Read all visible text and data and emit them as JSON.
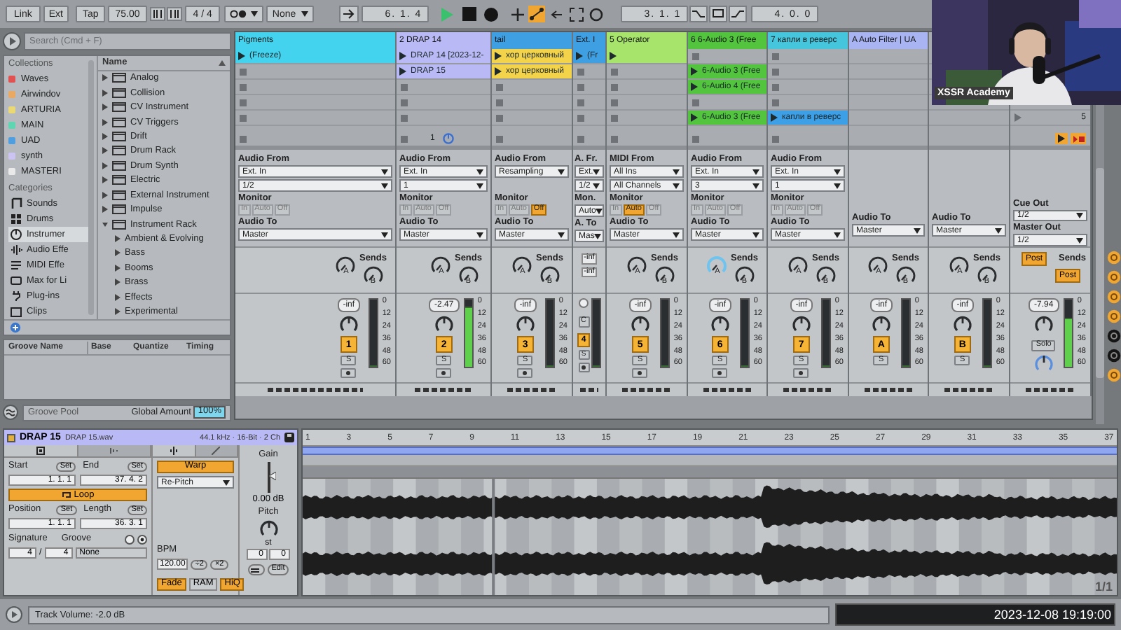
{
  "transport": {
    "link": "Link",
    "ext": "Ext",
    "tap": "Tap",
    "tempo": "75.00",
    "signature": "4 / 4",
    "quantize": "None",
    "position": "6. 1. 4",
    "playing": true,
    "loop_start": "3. 1. 1",
    "loop_length": "4. 0. 0"
  },
  "browser": {
    "search": {
      "placeholder": "Search (Cmd + F)"
    },
    "collections_label": "Collections",
    "collections": [
      {
        "label": "Waves",
        "color": "#e05252"
      },
      {
        "label": "Airwindov",
        "color": "#e9a963"
      },
      {
        "label": "ARTURIA",
        "color": "#e9d873"
      },
      {
        "label": "MAIN",
        "color": "#5fd6b2"
      },
      {
        "label": "UAD",
        "color": "#4f9fe0"
      },
      {
        "label": "synth",
        "color": "#cbc3f2"
      },
      {
        "label": "MASTERI",
        "color": "#e9e9e9"
      }
    ],
    "categories_label": "Categories",
    "categories": [
      {
        "label": "Sounds",
        "selected": false
      },
      {
        "label": "Drums",
        "selected": false
      },
      {
        "label": "Instrumer",
        "selected": true
      },
      {
        "label": "Audio Effe",
        "selected": false
      },
      {
        "label": "MIDI Effe",
        "selected": false
      },
      {
        "label": "Max for Li",
        "selected": false
      },
      {
        "label": "Plug-ins",
        "selected": false
      },
      {
        "label": "Clips",
        "selected": false
      }
    ],
    "name_header": "Name",
    "items": [
      {
        "label": "Analog",
        "expanded": false
      },
      {
        "label": "Collision",
        "expanded": false
      },
      {
        "label": "CV Instrument",
        "expanded": false
      },
      {
        "label": "CV Triggers",
        "expanded": false
      },
      {
        "label": "Drift",
        "expanded": false
      },
      {
        "label": "Drum Rack",
        "expanded": false
      },
      {
        "label": "Drum Synth",
        "expanded": false
      },
      {
        "label": "Electric",
        "expanded": false
      },
      {
        "label": "External Instrument",
        "expanded": false
      },
      {
        "label": "Impulse",
        "expanded": false
      },
      {
        "label": "Instrument Rack",
        "expanded": true,
        "children": [
          {
            "label": "Ambient & Evolving"
          },
          {
            "label": "Bass"
          },
          {
            "label": "Booms"
          },
          {
            "label": "Brass"
          },
          {
            "label": "Effects"
          },
          {
            "label": "Experimental"
          }
        ]
      }
    ]
  },
  "groove": {
    "columns": [
      "Groove Name",
      "Base",
      "Quantize",
      "Timing"
    ],
    "footer": "Groove Pool",
    "amount_label": "Global Amount",
    "amount": "100%"
  },
  "tracks": [
    {
      "kind": "audio",
      "name": "Pigments",
      "color": "#43d3ee",
      "slots": [
        {
          "kind": "clip",
          "text": "(Freeze)",
          "color": "#43d3ee"
        },
        {
          "kind": "empty"
        },
        {
          "kind": "empty"
        },
        {
          "kind": "empty"
        },
        {
          "kind": "empty"
        }
      ],
      "io": {
        "from_label": "Audio From",
        "from": "Ext. In",
        "channel": "1/2",
        "monitor_label": "Monitor",
        "monitor": [
          {
            "label": "In",
            "selected": false
          },
          {
            "label": "Auto",
            "selected": false
          },
          {
            "label": "Off",
            "selected": false
          }
        ],
        "to_label": "Audio To",
        "to": "Master"
      },
      "sends_label": "Sends",
      "sends": [
        {
          "label": "A",
          "active": false
        },
        {
          "label": "B",
          "active": false
        }
      ],
      "volume": "-inf",
      "number": "1",
      "solo": "S",
      "arm": true,
      "meter": {
        "level": 0
      },
      "scale": [
        "0",
        "12",
        "24",
        "36",
        "48",
        "60"
      ]
    },
    {
      "kind": "audio",
      "name": "2 DRAP 14",
      "color": "#b9b9f5",
      "slots": [
        {
          "kind": "clip",
          "text": "DRAP 14 [2023-12-",
          "color": "#b9b9f5"
        },
        {
          "kind": "clip",
          "text": "DRAP 15",
          "color": "#b9b9f5"
        },
        {
          "kind": "empty"
        },
        {
          "kind": "empty"
        },
        {
          "kind": "empty"
        }
      ],
      "stop_label": "1",
      "io": {
        "from_label": "Audio From",
        "from": "Ext. In",
        "channel": "1",
        "monitor_label": "Monitor",
        "monitor": [
          {
            "label": "In",
            "selected": false
          },
          {
            "label": "Auto",
            "selected": false
          },
          {
            "label": "Off",
            "selected": false
          }
        ],
        "to_label": "Audio To",
        "to": "Master"
      },
      "sends_label": "Sends",
      "sends": [
        {
          "label": "A",
          "active": false
        },
        {
          "label": "B",
          "active": false
        }
      ],
      "volume": "-2.47",
      "number": "2",
      "solo": "S",
      "arm": true,
      "meter": {
        "level": 0.88
      },
      "scale": [
        "0",
        "12",
        "24",
        "36",
        "48",
        "60"
      ]
    },
    {
      "kind": "audio",
      "name": "tail",
      "color": "#3f9fe3",
      "slots": [
        {
          "kind": "clip",
          "text": "хор церковный",
          "color": "#f3d349"
        },
        {
          "kind": "clip",
          "text": "хор церковный",
          "color": "#f3d349"
        },
        {
          "kind": "empty"
        },
        {
          "kind": "empty"
        },
        {
          "kind": "empty"
        }
      ],
      "io": {
        "from_label": "Audio From",
        "from": "Resampling",
        "monitor_label": "Monitor",
        "monitor": [
          {
            "label": "In",
            "selected": false
          },
          {
            "label": "Auto",
            "selected": false
          },
          {
            "label": "Off",
            "selected": true
          }
        ],
        "to_label": "Audio To",
        "to": "Master"
      },
      "sends_label": "Sends",
      "sends": [
        {
          "label": "A",
          "active": false
        },
        {
          "label": "B",
          "active": false
        }
      ],
      "volume": "-inf",
      "number": "3",
      "solo": "S",
      "arm": true,
      "meter": {
        "level": 0
      },
      "scale": [
        "0",
        "12",
        "24",
        "36",
        "48",
        "60"
      ]
    },
    {
      "kind": "narrow",
      "name": "Ext. I",
      "color": "#3f9fe3",
      "slots": [
        {
          "kind": "clip",
          "text": "(Fr",
          "color": "#3f9fe3"
        },
        {
          "kind": "empty"
        },
        {
          "kind": "empty"
        },
        {
          "kind": "empty"
        },
        {
          "kind": "empty"
        }
      ],
      "io": {
        "from_label": "A. Fr.",
        "from": "Ext.",
        "channel": "1/2",
        "monitor_label": "Mon.",
        "monitor_value": "Auto",
        "to_label": "A. To",
        "to": "Mas"
      },
      "send_values": [
        "-inf",
        "-inf"
      ],
      "crossfade": "C",
      "number": "4",
      "solo": "S",
      "arm": true,
      "meter": {
        "level": 0
      }
    },
    {
      "kind": "midi",
      "name": "5 Operator",
      "color": "#a6e46c",
      "slots": [
        {
          "kind": "clip",
          "color": "#a6e46c"
        },
        {
          "kind": "empty"
        },
        {
          "kind": "empty"
        },
        {
          "kind": "empty"
        },
        {
          "kind": "empty"
        }
      ],
      "io": {
        "from_label": "MIDI From",
        "from": "All Ins",
        "channel": "All Channels",
        "monitor_label": "Monitor",
        "monitor": [
          {
            "label": "In",
            "selected": false
          },
          {
            "label": "Auto",
            "selected": true
          },
          {
            "label": "Off",
            "selected": false
          }
        ],
        "to_label": "Audio To",
        "to": "Master"
      },
      "sends_label": "Sends",
      "sends": [
        {
          "label": "A",
          "active": false
        },
        {
          "label": "B",
          "active": false
        }
      ],
      "volume": "-inf",
      "number": "5",
      "solo": "S",
      "arm": true,
      "meter": {
        "level": 0
      },
      "scale": [
        "0",
        "12",
        "24",
        "36",
        "48",
        "60"
      ]
    },
    {
      "kind": "audio",
      "name": "6 6-Audio 3 (Free",
      "color": "#52c43d",
      "slots": [
        {
          "kind": "empty"
        },
        {
          "kind": "clip",
          "text": "6-Audio 3 (Free",
          "color": "#52c43d"
        },
        {
          "kind": "clip",
          "text": "6-Audio 4 (Free",
          "color": "#52c43d"
        },
        {
          "kind": "empty"
        },
        {
          "kind": "clip",
          "text": "6-Audio 3 (Free",
          "color": "#52c43d"
        }
      ],
      "io": {
        "from_label": "Audio From",
        "from": "Ext. In",
        "channel": "3",
        "monitor_label": "Monitor",
        "monitor": [
          {
            "label": "In",
            "selected": false
          },
          {
            "label": "Auto",
            "selected": false
          },
          {
            "label": "Off",
            "selected": false
          }
        ],
        "to_label": "Audio To",
        "to": "Master"
      },
      "sends_label": "Sends",
      "sends": [
        {
          "label": "A",
          "active": true
        },
        {
          "label": "B",
          "active": false
        }
      ],
      "volume": "-inf",
      "number": "6",
      "solo": "S",
      "arm": true,
      "meter": {
        "level": 0
      },
      "scale": [
        "0",
        "12",
        "24",
        "36",
        "48",
        "60"
      ]
    },
    {
      "kind": "audio",
      "name": "7 капли в реверс",
      "color": "#45c6dc",
      "slots": [
        {
          "kind": "empty"
        },
        {
          "kind": "empty"
        },
        {
          "kind": "empty"
        },
        {
          "kind": "empty"
        },
        {
          "kind": "clip",
          "text": "капли в реверс",
          "color": "#3d9fe6"
        }
      ],
      "io": {
        "from_label": "Audio From",
        "from": "Ext. In",
        "channel": "1",
        "monitor_label": "Monitor",
        "monitor": [
          {
            "label": "In",
            "selected": false
          },
          {
            "label": "Auto",
            "selected": false
          },
          {
            "label": "Off",
            "selected": false
          }
        ],
        "to_label": "Audio To",
        "to": "Master"
      },
      "sends_label": "Sends",
      "sends": [
        {
          "label": "A",
          "active": false
        },
        {
          "label": "B",
          "active": false
        }
      ],
      "volume": "-inf",
      "number": "7",
      "solo": "S",
      "arm": true,
      "meter": {
        "level": 0
      },
      "scale": [
        "0",
        "12",
        "24",
        "36",
        "48",
        "60"
      ]
    },
    {
      "kind": "return",
      "name": "A Auto Filter | UA",
      "color": "#a9b5f2",
      "io": {
        "to_label": "Audio To",
        "to": "Master"
      },
      "sends_label": "Sends",
      "sends": [
        {
          "label": "A",
          "active": false
        },
        {
          "label": "B",
          "active": false
        }
      ],
      "volume": "-inf",
      "number": "A",
      "solo": "S",
      "meter": {
        "level": 0
      },
      "scale": [
        "0",
        "12",
        "24",
        "36",
        "48",
        "60"
      ]
    },
    {
      "kind": "return",
      "io": {
        "to_label": "Audio To",
        "to": "Master"
      },
      "sends_label": "Sends",
      "sends": [
        {
          "label": "A",
          "active": false
        },
        {
          "label": "B",
          "active": false
        }
      ],
      "volume": "-inf",
      "number": "B",
      "solo": "S",
      "meter": {
        "level": 0
      },
      "scale": [
        "0",
        "12",
        "24",
        "36",
        "48",
        "60"
      ]
    },
    {
      "kind": "master",
      "slots": [
        {
          "kind": "blank"
        },
        {
          "kind": "blank"
        },
        {
          "kind": "blank"
        },
        {
          "kind": "blank"
        },
        {
          "kind": "scene",
          "text": "5"
        }
      ],
      "io": {
        "cue_label": "Cue Out",
        "cue": "1/2",
        "out_label": "Master Out",
        "out": "1/2"
      },
      "sends_label": "Sends",
      "sends": [
        {
          "label": "Post",
          "active": true
        },
        {
          "label": "Post",
          "active": true
        }
      ],
      "volume": "-7.94",
      "solo": "Solo",
      "meter": {
        "level": 0.7
      },
      "scale": [
        "0",
        "12",
        "24",
        "36",
        "48",
        "60"
      ]
    }
  ],
  "clip": {
    "title": "DRAP 15",
    "file": "DRAP 15.wav",
    "format": "44.1 kHz · 16-Bit · 2 Ch",
    "start": {
      "label": "Start",
      "set": "Set",
      "value": "1.  1.  1"
    },
    "end": {
      "label": "End",
      "set": "Set",
      "value": "37.  4.  2"
    },
    "loop": {
      "label": "Loop",
      "on": true
    },
    "position": {
      "label": "Position",
      "set": "Set",
      "value": "1.  1.  1"
    },
    "length": {
      "label": "Length",
      "set": "Set",
      "value": "36.  3.  1"
    },
    "signature": {
      "label": "Signature",
      "numerator": "4",
      "separator": "/",
      "denominator": "4"
    },
    "groove": {
      "label": "Groove",
      "value": "None"
    },
    "warp": {
      "label": "Warp",
      "on": true
    },
    "warp_mode": "Re-Pitch",
    "bpm": {
      "label": "BPM",
      "value": "120.00",
      "half": "÷2",
      "double": "×2"
    },
    "toggles": [
      {
        "label": "Fade",
        "on": true
      },
      {
        "label": "RAM",
        "on": false
      },
      {
        "label": "HiQ",
        "on": true
      }
    ],
    "gain": {
      "label": "Gain",
      "value": "0.00 dB",
      "level": 0.55
    },
    "pitch": {
      "label": "Pitch",
      "unit": "st",
      "coarse": "0",
      "fine": "0"
    },
    "edit": "Edit"
  },
  "waveform": {
    "ruler": [
      "1",
      "3",
      "5",
      "7",
      "9",
      "11",
      "13",
      "15",
      "17",
      "19",
      "21",
      "23",
      "25",
      "27",
      "29",
      "31",
      "33",
      "35",
      "37"
    ],
    "page": "1/1"
  },
  "status": {
    "message": "Track Volume: -2.0 dB",
    "timestamp": "2023-12-08 19:19:00"
  },
  "webcam": {
    "kind": "picture",
    "caption": "XSSR Academy"
  }
}
